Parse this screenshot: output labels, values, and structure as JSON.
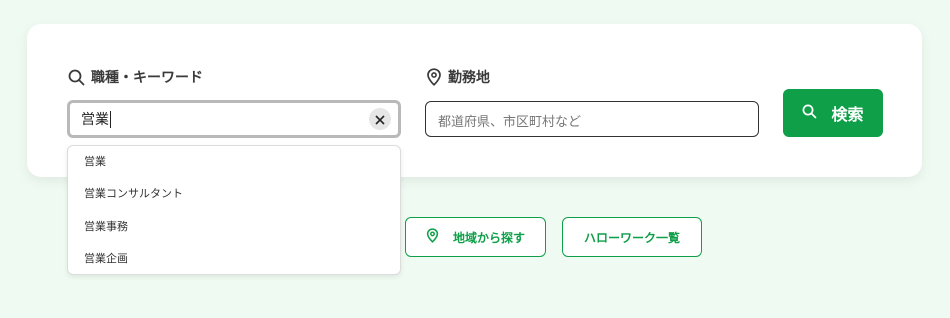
{
  "search": {
    "keyword_label": "職種・キーワード",
    "keyword_value": "営業",
    "location_label": "勤務地",
    "location_placeholder": "都道府県、市区町村など",
    "button_label": "検索"
  },
  "suggestions": [
    "営業",
    "営業コンサルタント",
    "営業事務",
    "営業企画"
  ],
  "links": {
    "area": "地域から探す",
    "hellowork": "ハローワーク一覧"
  },
  "colors": {
    "accent": "#0e9f48",
    "background": "#effbf2"
  },
  "icons": {
    "keyword": "search-icon",
    "location": "map-pin-icon",
    "clear": "close-icon",
    "button": "search-icon",
    "area": "map-pin-icon"
  }
}
